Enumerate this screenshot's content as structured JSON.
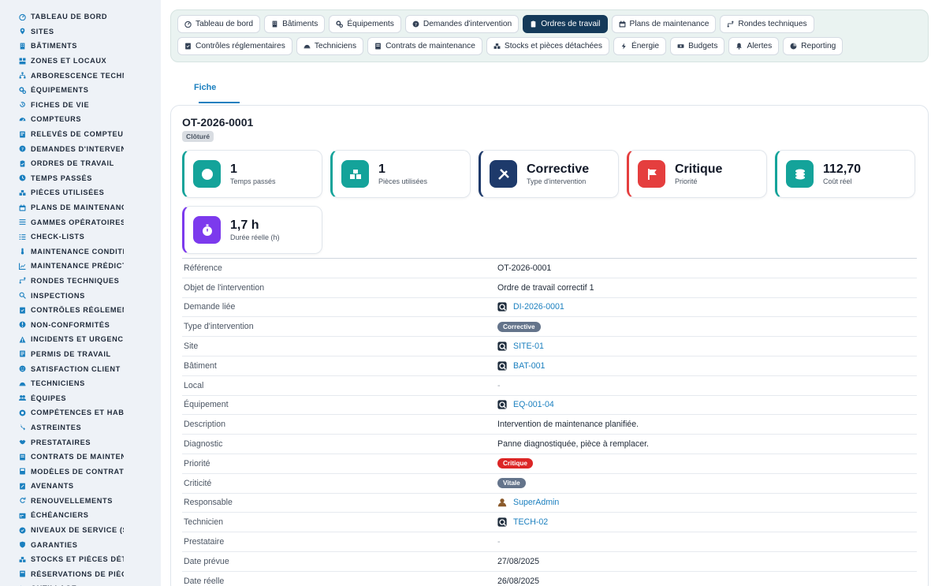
{
  "sidebar": {
    "items": [
      {
        "label": "TABLEAU DE BORD",
        "icon": "dashboard-icon"
      },
      {
        "label": "SITES",
        "icon": "map-pin-icon"
      },
      {
        "label": "BÂTIMENTS",
        "icon": "building-icon"
      },
      {
        "label": "ZONES ET LOCAUX",
        "icon": "zones-icon"
      },
      {
        "label": "ARBORESCENCE TECHNI",
        "icon": "tree-icon"
      },
      {
        "label": "ÉQUIPEMENTS",
        "icon": "gears-icon"
      },
      {
        "label": "FICHES DE VIE",
        "icon": "history-icon"
      },
      {
        "label": "COMPTEURS",
        "icon": "gauge-icon"
      },
      {
        "label": "RELEVÉS DE COMPTEURS",
        "icon": "reading-icon"
      },
      {
        "label": "DEMANDES D'INTERVENT",
        "icon": "question-icon"
      },
      {
        "label": "ORDRES DE TRAVAIL",
        "icon": "clipboard-icon"
      },
      {
        "label": "TEMPS PASSÉS",
        "icon": "clock-icon"
      },
      {
        "label": "PIÈCES UTILISÉES",
        "icon": "boxes-icon"
      },
      {
        "label": "PLANS DE MAINTENANCE",
        "icon": "calendar-icon"
      },
      {
        "label": "GAMMES OPÉRATOIRES",
        "icon": "list-icon"
      },
      {
        "label": "CHECK-LISTS",
        "icon": "checklist-icon"
      },
      {
        "label": "MAINTENANCE CONDITIO",
        "icon": "thermometer-icon"
      },
      {
        "label": "MAINTENANCE PRÉDICTI",
        "icon": "chart-icon"
      },
      {
        "label": "RONDES TECHNIQUES",
        "icon": "route-icon"
      },
      {
        "label": "INSPECTIONS",
        "icon": "search-icon"
      },
      {
        "label": "CONTRÔLES RÉGLEMENT",
        "icon": "check-doc-icon"
      },
      {
        "label": "NON-CONFORMITÉS",
        "icon": "exclamation-icon"
      },
      {
        "label": "INCIDENTS ET URGENCES",
        "icon": "warning-icon"
      },
      {
        "label": "PERMIS DE TRAVAIL",
        "icon": "permit-icon"
      },
      {
        "label": "SATISFACTION CLIENT",
        "icon": "smile-icon"
      },
      {
        "label": "TECHNICIENS",
        "icon": "helmet-icon"
      },
      {
        "label": "ÉQUIPES",
        "icon": "users-icon"
      },
      {
        "label": "COMPÉTENCES ET HABIL",
        "icon": "certificate-icon"
      },
      {
        "label": "ASTREINTES",
        "icon": "phone-icon"
      },
      {
        "label": "PRESTATAIRES",
        "icon": "handshake-icon"
      },
      {
        "label": "CONTRATS DE MAINTENA",
        "icon": "contract-icon"
      },
      {
        "label": "MODÈLES DE CONTRATS",
        "icon": "template-icon"
      },
      {
        "label": "AVENANTS",
        "icon": "amend-icon"
      },
      {
        "label": "RENOUVELLEMENTS",
        "icon": "refresh-icon"
      },
      {
        "label": "ÉCHÉANCIERS",
        "icon": "schedule-icon"
      },
      {
        "label": "NIVEAUX DE SERVICE (SL",
        "icon": "sla-icon"
      },
      {
        "label": "GARANTIES",
        "icon": "shield-icon"
      },
      {
        "label": "STOCKS ET PIÈCES DÉTA",
        "icon": "stock-icon"
      },
      {
        "label": "RÉSERVATIONS DE PIÈCE",
        "icon": "reservation-icon"
      },
      {
        "label": "OUTILLAGE",
        "icon": "tools-icon"
      }
    ]
  },
  "topnav": {
    "row1": [
      {
        "label": "Tableau de bord",
        "icon": "dashboard-icon"
      },
      {
        "label": "Bâtiments",
        "icon": "building-icon"
      },
      {
        "label": "Équipements",
        "icon": "gears-icon"
      },
      {
        "label": "Demandes d'intervention",
        "icon": "question-icon"
      },
      {
        "label": "Ordres de travail",
        "icon": "clipboard-icon",
        "active": true
      },
      {
        "label": "Plans de maintenance",
        "icon": "calendar-icon"
      },
      {
        "label": "Rondes techniques",
        "icon": "route-icon"
      }
    ],
    "row2": [
      {
        "label": "Contrôles réglementaires",
        "icon": "check-doc-icon"
      },
      {
        "label": "Techniciens",
        "icon": "helmet-icon"
      },
      {
        "label": "Contrats de maintenance",
        "icon": "contract-icon"
      },
      {
        "label": "Stocks et pièces détachées",
        "icon": "stock-icon"
      },
      {
        "label": "Énergie",
        "icon": "bolt-icon"
      },
      {
        "label": "Budgets",
        "icon": "money-icon"
      },
      {
        "label": "Alertes",
        "icon": "bell-icon"
      },
      {
        "label": "Reporting",
        "icon": "pie-icon"
      }
    ]
  },
  "tabs": [
    {
      "label": "Fiche"
    }
  ],
  "record": {
    "title": "OT-2026-0001",
    "status": "Clôturé"
  },
  "kpis": [
    {
      "value": "1",
      "label": "Temps passés",
      "icon": "clock-icon",
      "color": "#14a39a"
    },
    {
      "value": "1",
      "label": "Pièces utilisées",
      "icon": "boxes-icon",
      "color": "#14a39a"
    },
    {
      "value": "Corrective",
      "label": "Type d'intervention",
      "icon": "tools-icon",
      "color": "#1e3a6b"
    },
    {
      "value": "Critique",
      "label": "Priorité",
      "icon": "flag-icon",
      "color": "#e53e3e"
    },
    {
      "value": "112,70",
      "label": "Coût réel",
      "icon": "coins-icon",
      "color": "#14a39a"
    },
    {
      "value": "1,7 h",
      "label": "Durée réelle (h)",
      "icon": "stopwatch-icon",
      "color": "#7c3aed"
    }
  ],
  "fields": [
    {
      "key": "Référence",
      "value": "OT-2026-0001",
      "type": "text"
    },
    {
      "key": "Objet de l'intervention",
      "value": "Ordre de travail correctif 1",
      "type": "text"
    },
    {
      "key": "Demande liée",
      "value": "DI-2026-0001",
      "type": "link"
    },
    {
      "key": "Type d'intervention",
      "value": "Corrective",
      "type": "pill",
      "color": "#64748b"
    },
    {
      "key": "Site",
      "value": "SITE-01",
      "type": "link"
    },
    {
      "key": "Bâtiment",
      "value": "BAT-001",
      "type": "link"
    },
    {
      "key": "Local",
      "value": "-",
      "type": "dash"
    },
    {
      "key": "Équipement",
      "value": "EQ-001-04",
      "type": "link"
    },
    {
      "key": "Description",
      "value": "Intervention de maintenance planifiée.",
      "type": "text"
    },
    {
      "key": "Diagnostic",
      "value": "Panne diagnostiquée, pièce à remplacer.",
      "type": "text"
    },
    {
      "key": "Priorité",
      "value": "Critique",
      "type": "pill",
      "color": "#dc2626"
    },
    {
      "key": "Criticité",
      "value": "Vitale",
      "type": "pill",
      "color": "#64748b"
    },
    {
      "key": "Responsable",
      "value": "SuperAdmin",
      "type": "user"
    },
    {
      "key": "Technicien",
      "value": "TECH-02",
      "type": "link"
    },
    {
      "key": "Prestataire",
      "value": "-",
      "type": "dash"
    },
    {
      "key": "Date prévue",
      "value": "27/08/2025",
      "type": "text"
    },
    {
      "key": "Date réelle",
      "value": "26/08/2025",
      "type": "text"
    }
  ],
  "colors": {
    "accent": "#1a7fbf",
    "active_nav": "#143a5a",
    "sidebar_bg": "#eef2f7",
    "nav_bg": "#eaf3f1"
  }
}
